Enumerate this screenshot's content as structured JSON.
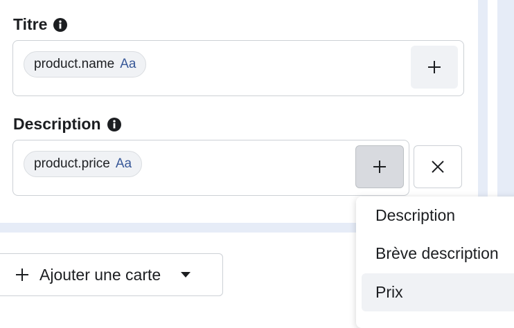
{
  "fields": {
    "title": {
      "label": "Titre",
      "token": "product.name",
      "token_type": "Aa"
    },
    "description": {
      "label": "Description",
      "token": "product.price",
      "token_type": "Aa"
    }
  },
  "add_card": {
    "label": "Ajouter une carte"
  },
  "dropdown": {
    "items": [
      {
        "label": "Description"
      },
      {
        "label": "Brève description"
      },
      {
        "label": "Prix"
      }
    ],
    "highlighted": "Prix"
  },
  "colors": {
    "link_blue": "#385898",
    "chip_bg": "#f0f2f5",
    "frame_stripe": "#e6ecf7"
  },
  "icons": [
    "info-icon",
    "plus-icon",
    "close-icon",
    "caret-down-icon"
  ]
}
